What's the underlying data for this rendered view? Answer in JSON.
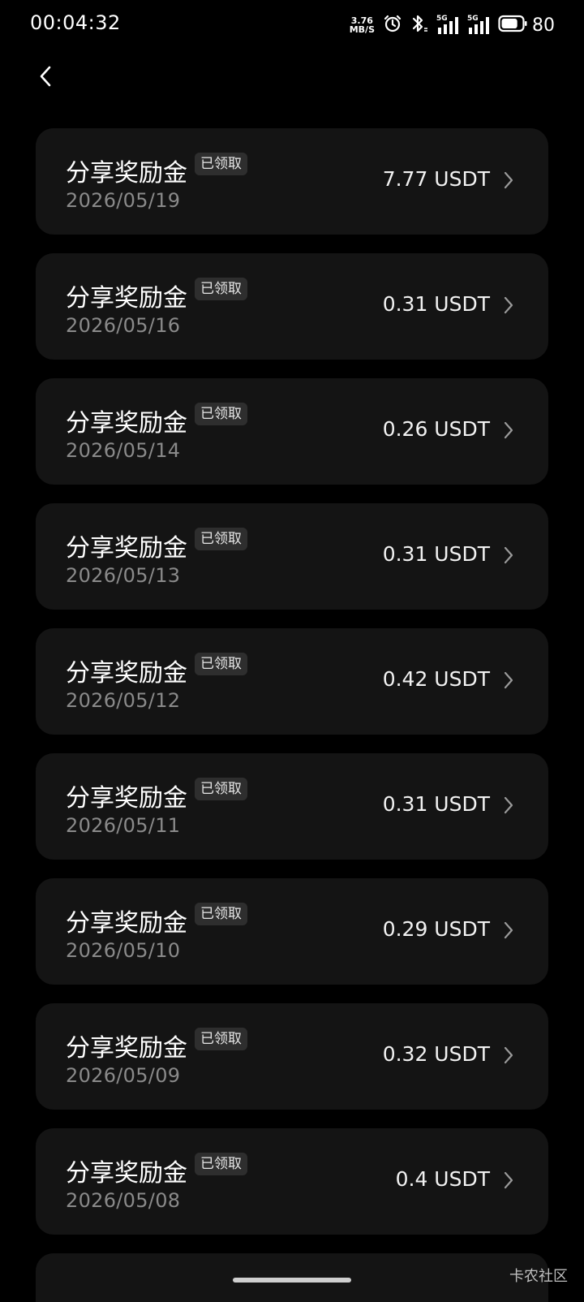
{
  "status_bar": {
    "time": "00:04:32",
    "net_speed_value": "3.76",
    "net_speed_unit": "MB/S",
    "signal_label_1": "5G",
    "signal_label_2": "5G",
    "battery_level": "80",
    "battery_fraction": 0.8
  },
  "records": [
    {
      "title": "分享奖励金",
      "badge": "已领取",
      "date": "2026/05/19",
      "amount": "7.77 USDT"
    },
    {
      "title": "分享奖励金",
      "badge": "已领取",
      "date": "2026/05/16",
      "amount": "0.31 USDT"
    },
    {
      "title": "分享奖励金",
      "badge": "已领取",
      "date": "2026/05/14",
      "amount": "0.26 USDT"
    },
    {
      "title": "分享奖励金",
      "badge": "已领取",
      "date": "2026/05/13",
      "amount": "0.31 USDT"
    },
    {
      "title": "分享奖励金",
      "badge": "已领取",
      "date": "2026/05/12",
      "amount": "0.42 USDT"
    },
    {
      "title": "分享奖励金",
      "badge": "已领取",
      "date": "2026/05/11",
      "amount": "0.31 USDT"
    },
    {
      "title": "分享奖励金",
      "badge": "已领取",
      "date": "2026/05/10",
      "amount": "0.29 USDT"
    },
    {
      "title": "分享奖励金",
      "badge": "已领取",
      "date": "2026/05/09",
      "amount": "0.32 USDT"
    },
    {
      "title": "分享奖励金",
      "badge": "已领取",
      "date": "2026/05/08",
      "amount": "0.4 USDT"
    }
  ],
  "watermark": "卡农社区",
  "colors": {
    "background": "#000000",
    "card": "#141414",
    "badge": "#2e2e2e",
    "date_text": "#8a8a8a"
  }
}
